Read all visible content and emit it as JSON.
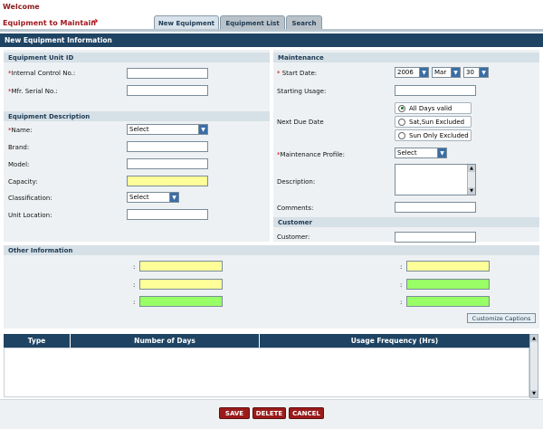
{
  "header": {
    "welcome": "Welcome",
    "equip_title": "Equipment to Maintain",
    "arrow_icon": "arrow-right-icon"
  },
  "tabs": [
    {
      "label": "New Equipment",
      "active": true
    },
    {
      "label": "Equipment List",
      "active": false
    },
    {
      "label": "Search",
      "active": false
    }
  ],
  "main_title": "New Equipment Information",
  "unit_id": {
    "title": "Equipment Unit ID",
    "control_label": "Internal Control No.:",
    "serial_label": "Mfr. Serial No.:",
    "required_mark": "*"
  },
  "description": {
    "title": "Equipment Description",
    "name_label": "Name:",
    "name_value": "Select",
    "brand_label": "Brand:",
    "model_label": "Model:",
    "capacity_label": "Capacity:",
    "classification_label": "Classification:",
    "classification_value": "Select",
    "location_label": "Unit Location:"
  },
  "maintenance": {
    "title": "Maintenance",
    "start_label": "Start Date:",
    "year": "2006",
    "month": "Mar",
    "day": "30",
    "usage_label": "Starting Usage:",
    "next_due_label": "Next Due Date",
    "radio_options": [
      "All Days valid",
      "Sat,Sun Excluded",
      "Sun Only Excluded"
    ],
    "selected_index": 0,
    "profile_label": "Maintenance Profile:",
    "profile_value": "Select",
    "description_label": "Description:",
    "comments_label": "Comments:"
  },
  "customer": {
    "title": "Customer",
    "label": "Customer:"
  },
  "other": {
    "title": "Other Information",
    "colon": ":",
    "customize_label": "Customize Captions",
    "left_colors": [
      "yellow",
      "yellow",
      "green"
    ],
    "right_colors": [
      "yellow",
      "green",
      "green"
    ]
  },
  "grid": {
    "columns": [
      "Type",
      "Number of Days",
      "Usage Frequency (Hrs)"
    ]
  },
  "actions": {
    "save": "SAVE",
    "delete": "DELETE",
    "cancel": "CANCEL"
  },
  "colors": {
    "header_bg": "#1f4463",
    "required": "#cc0000",
    "field_yellow": "#ffff99",
    "field_green": "#99ff66",
    "button_red": "#9b1b1b"
  }
}
